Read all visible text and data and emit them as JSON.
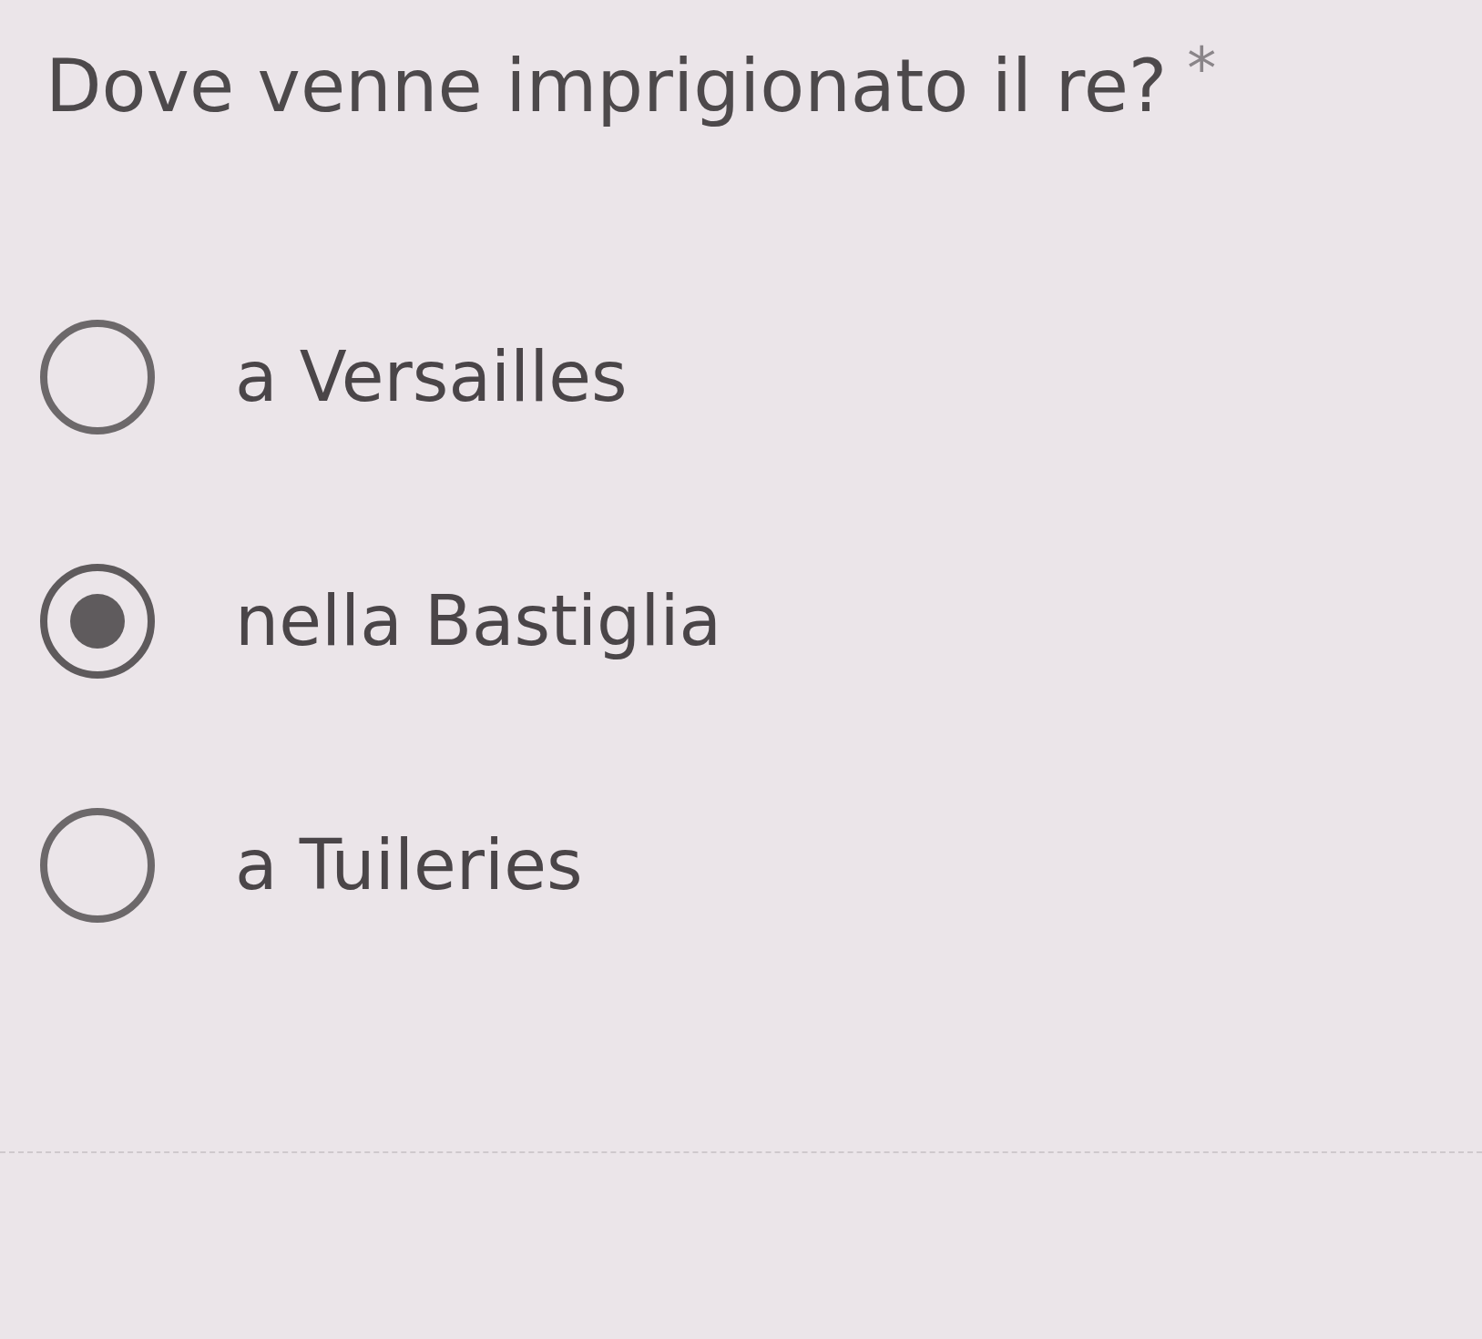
{
  "question": {
    "title": "Dove venne imprigionato il re?",
    "required_mark": "*"
  },
  "options": [
    {
      "label": "a Versailles",
      "selected": false
    },
    {
      "label": "nella Bastiglia",
      "selected": true
    },
    {
      "label": "a Tuileries",
      "selected": false
    }
  ]
}
